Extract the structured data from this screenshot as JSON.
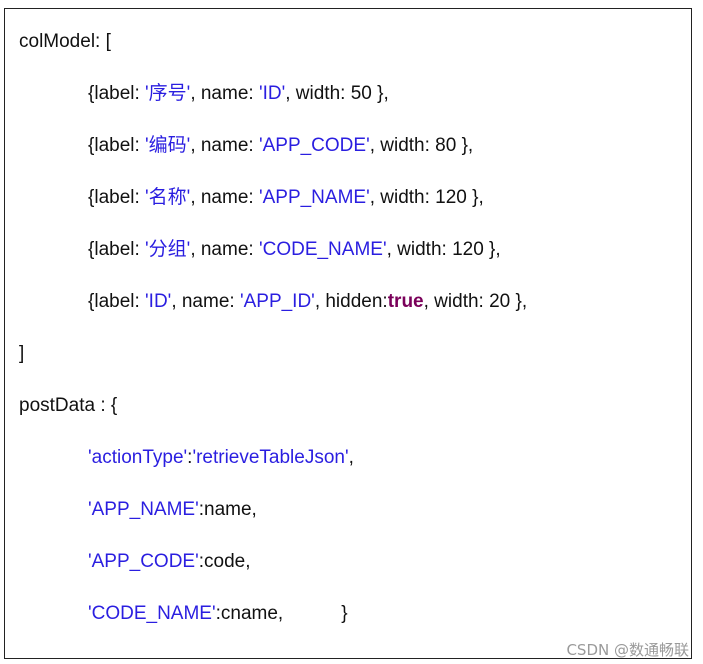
{
  "code": {
    "col_model_open": "colModel: [",
    "rows": [
      {
        "prefix": "{label: ",
        "label": "'序号'",
        "mid": ", name: ",
        "name": "'ID'",
        "suffix": ", width: 50 },"
      },
      {
        "prefix": "{label: ",
        "label": "'编码'",
        "mid": ", name: ",
        "name": "'APP_CODE'",
        "suffix": ", width: 80 },"
      },
      {
        "prefix": "{label: ",
        "label": "'名称'",
        "mid": ", name: ",
        "name": "'APP_NAME'",
        "suffix": ", width: 120 },"
      },
      {
        "prefix": "{label: ",
        "label": "'分组'",
        "mid": ", name: ",
        "name": "'CODE_NAME'",
        "suffix": ", width: 120 },"
      },
      {
        "prefix": "{label: ",
        "label": "'ID'",
        "mid": ", name: ",
        "name": "'APP_ID'",
        "hidden_prefix": ", hidden:",
        "hidden_value": "true",
        "suffix": ", width: 20 },"
      }
    ],
    "col_model_close": "]",
    "post_data_open": "postData : {",
    "post_data": [
      {
        "key": "'actionType'",
        "sep": ":",
        "value": "'retrieveTableJson'",
        "tail": ","
      },
      {
        "key": "'APP_NAME'",
        "sep": ":",
        "value": "name,",
        "tail": ""
      },
      {
        "key": "'APP_CODE'",
        "sep": ":",
        "value": "code,",
        "tail": ""
      },
      {
        "key": "'CODE_NAME'",
        "sep": ":",
        "value": "cname,",
        "tail": "           }"
      }
    ]
  },
  "watermark": "CSDN @数通畅联",
  "colors": {
    "string": "#2a1ee0",
    "keyword": "#7a005a",
    "text": "#111111",
    "watermark": "#9a9a9a"
  }
}
